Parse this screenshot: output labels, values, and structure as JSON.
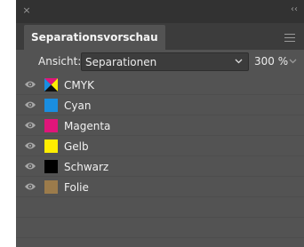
{
  "panel": {
    "close_glyph": "×",
    "collapse_glyph": "‹‹",
    "title": "Separationsvorschau",
    "menu_icon": "hamburger-menu-icon"
  },
  "view": {
    "label": "Ansicht:",
    "selected": "Separationen",
    "zoom": "300 %"
  },
  "separations": [
    {
      "name": "CMYK",
      "color": "composite-cmyk",
      "visible": true
    },
    {
      "name": "Cyan",
      "color": "#1a8ee0",
      "visible": true
    },
    {
      "name": "Magenta",
      "color": "#e0157a",
      "visible": true
    },
    {
      "name": "Gelb",
      "color": "#ffee00",
      "visible": true
    },
    {
      "name": "Schwarz",
      "color": "#000000",
      "visible": true
    },
    {
      "name": "Folie",
      "color": "#9b7b4b",
      "visible": true
    }
  ],
  "colors": {
    "panel_bg": "#535353",
    "topbar_bg": "#323232",
    "tabstrip_bg": "#3c3c3c"
  }
}
